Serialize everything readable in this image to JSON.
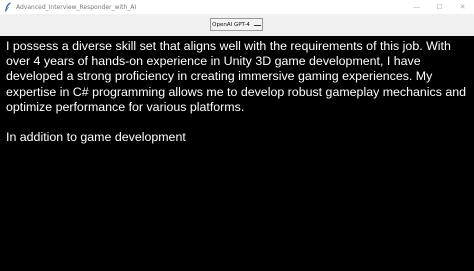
{
  "window": {
    "title": "Advanced_Interview_Responder_with_AI",
    "app_icon": "feather-icon",
    "controls": {
      "minimize": "—",
      "maximize": "☐",
      "close": "✕"
    }
  },
  "toolbar": {
    "model_select": {
      "selected": "OpenAI GPT-4"
    }
  },
  "response": {
    "paragraphs": [
      "I possess a diverse skill set that aligns well with the requirements of this job. With over 4 years of hands-on experience in Unity 3D game development, I have developed a strong proficiency in creating immersive gaming experiences. My expertise in C# programming allows me to develop robust gameplay mechanics and optimize performance for various platforms.",
      "In addition to game development"
    ]
  },
  "colors": {
    "background": "#000000",
    "text": "#ffffff",
    "titlebar": "#ffffff",
    "toolbar": "#f0f0f0"
  }
}
